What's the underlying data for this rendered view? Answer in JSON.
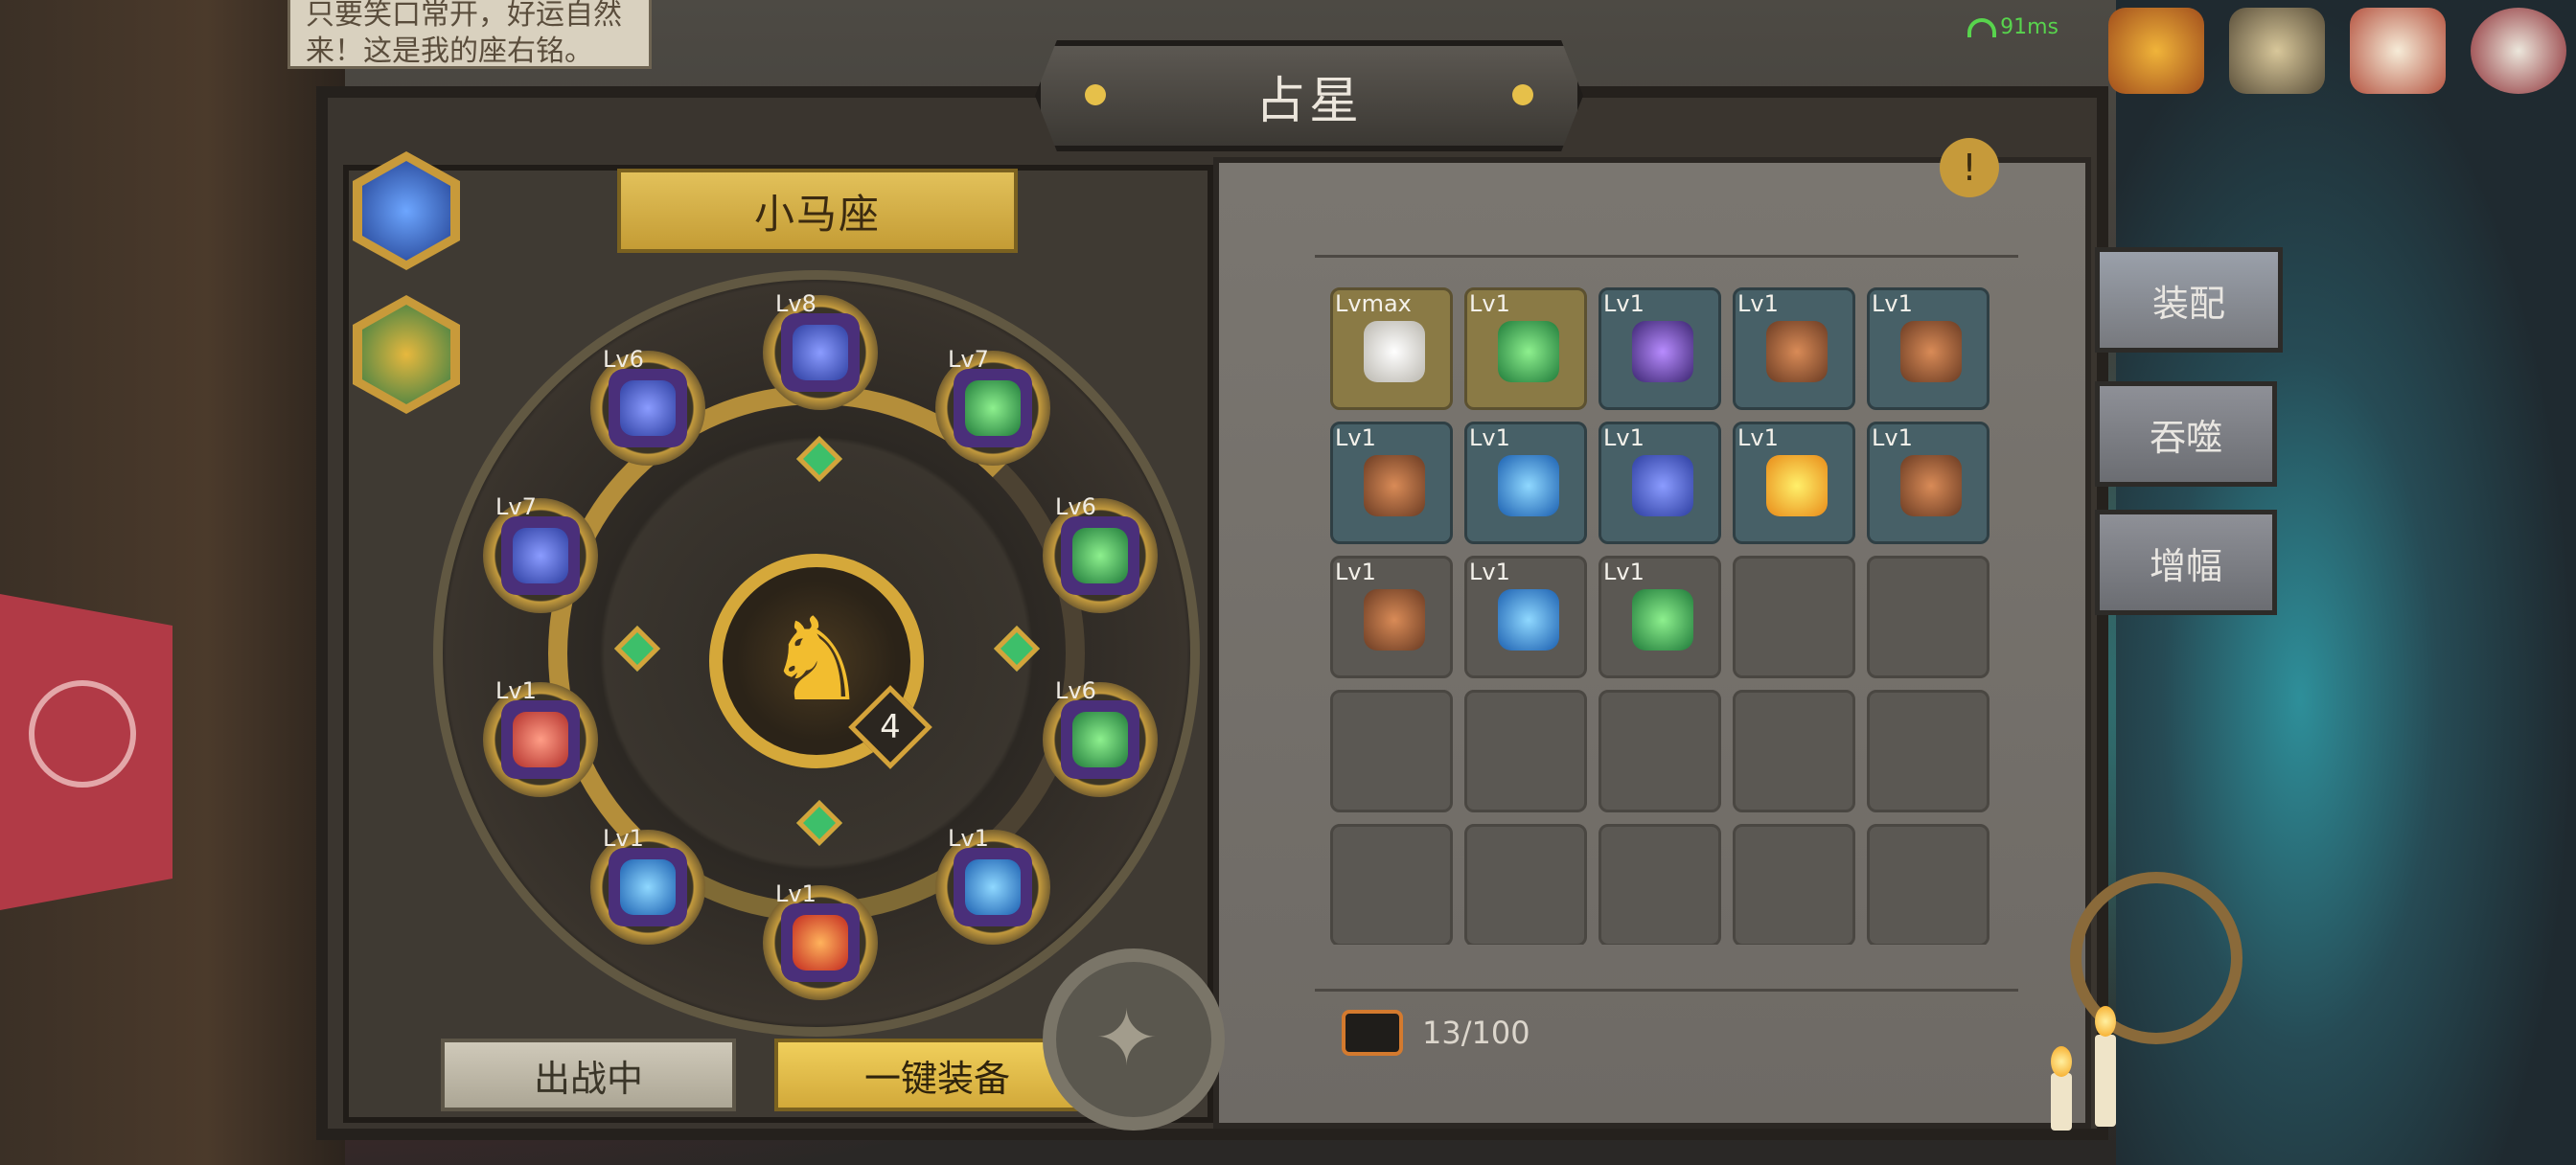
{
  "hud": {
    "ping": "91ms",
    "icons": [
      "trophy-chest-icon",
      "hammer-bow-icon",
      "gift-box-icon",
      "mail-icon"
    ]
  },
  "bg_tooltip": "只要笑口常开，好运自然来！这是我的座右铭。",
  "title": "占星",
  "constellation": {
    "name": "小马座",
    "level": "4",
    "slots": [
      {
        "lv": "Lv8",
        "rune": "r-blue-sword"
      },
      {
        "lv": "Lv7",
        "rune": "r-green-heart"
      },
      {
        "lv": "Lv6",
        "rune": "r-green-heart"
      },
      {
        "lv": "Lv6",
        "rune": "r-green-heart"
      },
      {
        "lv": "Lv1",
        "rune": "r-blue-flame"
      },
      {
        "lv": "Lv1",
        "rune": "r-red-flame"
      },
      {
        "lv": "Lv1",
        "rune": "r-blue-flame"
      },
      {
        "lv": "Lv1",
        "rune": "r-red-sword"
      },
      {
        "lv": "Lv7",
        "rune": "r-blue-sword"
      },
      {
        "lv": "Lv6",
        "rune": "r-blue-sword"
      }
    ]
  },
  "buttons": {
    "deploy": "出战中",
    "equip_all": "一键装备"
  },
  "tabs": {
    "equip": "装配",
    "devour": "吞噬",
    "amplify": "增幅"
  },
  "inventory": {
    "count": "13",
    "capacity": "/100",
    "items": [
      {
        "lv": "Lvmax",
        "rune": "r-white-max",
        "style": "gold"
      },
      {
        "lv": "Lv1",
        "rune": "r-green-heart",
        "style": "gold"
      },
      {
        "lv": "Lv1",
        "rune": "r-purple-moon",
        "style": "filled"
      },
      {
        "lv": "Lv1",
        "rune": "r-brown-wing",
        "style": "filled"
      },
      {
        "lv": "Lv1",
        "rune": "r-brown-wing",
        "style": "filled"
      },
      {
        "lv": "Lv1",
        "rune": "r-brown-wing",
        "style": "filled"
      },
      {
        "lv": "Lv1",
        "rune": "r-blue-flame",
        "style": "filled"
      },
      {
        "lv": "Lv1",
        "rune": "r-blue-sword",
        "style": "filled"
      },
      {
        "lv": "Lv1",
        "rune": "r-orange-burst",
        "style": "filled"
      },
      {
        "lv": "Lv1",
        "rune": "r-brown-wing",
        "style": "filled"
      },
      {
        "lv": "Lv1",
        "rune": "r-brown-wing",
        "style": "plain"
      },
      {
        "lv": "Lv1",
        "rune": "r-blue-flame",
        "style": "plain"
      },
      {
        "lv": "Lv1",
        "rune": "r-green-heart",
        "style": "plain"
      }
    ],
    "empty_cells": 12
  },
  "colors": {
    "gold_accent": "#d5a83a",
    "panel_bg": "#6e6a65",
    "deploy_btn": "#cfc9b9",
    "equip_btn": "#f0cf5b",
    "ping_green": "#58d44d"
  }
}
